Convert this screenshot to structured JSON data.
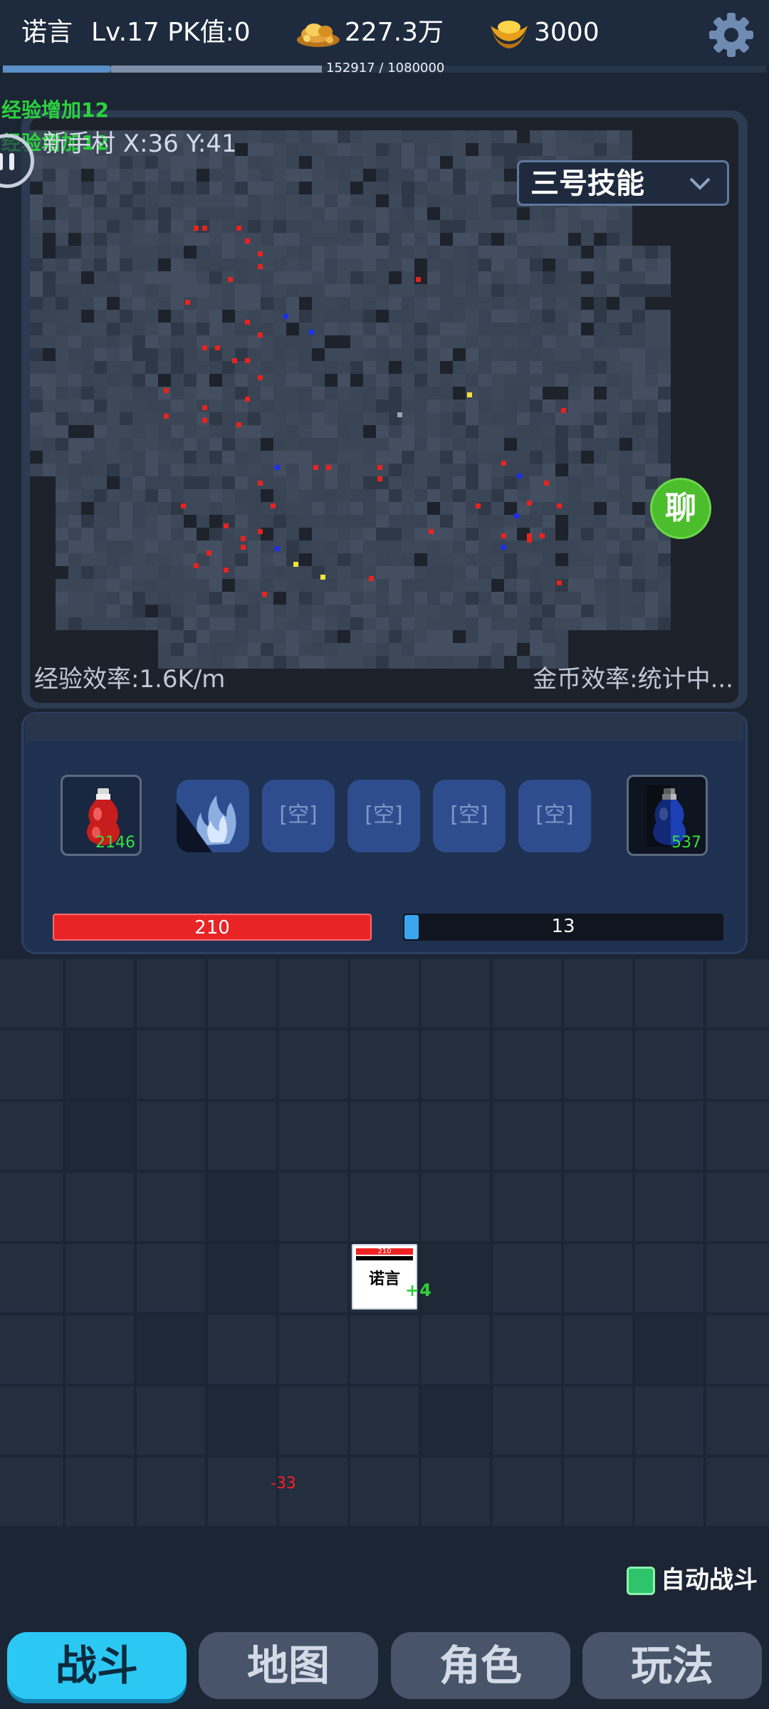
{
  "header": {
    "player_name": "诺言",
    "level_pk": "Lv.17 PK值:0",
    "gold": "227.3万",
    "ingots": "3000",
    "exp_text": "152917 / 1080000",
    "exp_progress": 0.1416
  },
  "combat_log": [
    "经验增加12",
    "经验增加12"
  ],
  "map": {
    "location": "新手村 X:36 Y:41",
    "skill_dropdown": "三号技能",
    "chat_label": "聊",
    "exp_rate": "经验效率:1.6K/m",
    "gold_rate": "金币效率:统计中..."
  },
  "skills": {
    "hp_potion_count": "2146",
    "mp_potion_count": "537",
    "empty_slots": [
      "[空]",
      "[空]",
      "[空]",
      "[空]"
    ],
    "hp_value": "210",
    "mp_value": "13",
    "mp_fraction": 0.04
  },
  "field": {
    "hero_name": "诺言",
    "hero_hp": "210",
    "heal_text": "+4",
    "damage_text": "-33",
    "auto_battle_label": "自动战斗"
  },
  "nav": {
    "tabs": [
      "战斗",
      "地图",
      "角色",
      "玩法"
    ],
    "active_index": 0
  },
  "colors": {
    "hp": "#e82426",
    "mp": "#3aa5ef",
    "active_tab": "#2cc8f4",
    "log_green": "#2bd23f",
    "enemy_marker": "#e8231f",
    "player_marker": "#1b2ff0",
    "item_marker": "#f2e23a"
  }
}
